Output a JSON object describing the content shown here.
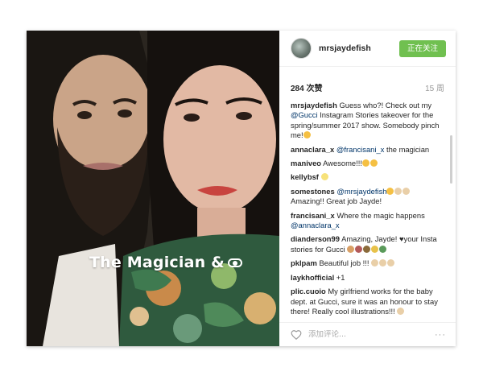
{
  "photo": {
    "overlay_text": "The Magician &"
  },
  "header": {
    "username": "mrsjaydefish",
    "follow_label": "正在关注"
  },
  "stats": {
    "likes": "284 次赞",
    "age": "15 周"
  },
  "comments": [
    {
      "user": "mrsjaydefish",
      "parts": [
        {
          "t": "Guess who?! Check out my "
        },
        {
          "t": "@Gucci",
          "m": true
        },
        {
          "t": " Instagram Stories takeover for the spring/summer 2017 show. Somebody pinch me!"
        }
      ],
      "emoji": [
        "#f5c043"
      ]
    },
    {
      "user": "annaclara_x",
      "parts": [
        {
          "t": "@francisani_x",
          "m": true
        },
        {
          "t": " the magician"
        }
      ],
      "emoji": []
    },
    {
      "user": "maniveo",
      "parts": [
        {
          "t": "Awesome!!!"
        }
      ],
      "emoji": [
        "#f5c043",
        "#f5c043"
      ]
    },
    {
      "user": "kellybsf",
      "parts": [
        {
          "t": ""
        }
      ],
      "emoji": [
        "#f7e27a"
      ]
    },
    {
      "user": "somestones",
      "parts": [
        {
          "t": "@mrsjaydefish",
          "m": true
        },
        {
          "t": " "
        },
        {
          "t": "Amazing!! Great job Jayde!"
        }
      ],
      "emoji_mid": [
        "#f5c043",
        "#e9cfa8",
        "#e9cfa8"
      ]
    },
    {
      "user": "francisani_x",
      "parts": [
        {
          "t": "Where the magic happens "
        },
        {
          "t": "@annaclara_x",
          "m": true
        }
      ],
      "emoji": []
    },
    {
      "user": "dianderson99",
      "parts": [
        {
          "t": "Amazing, Jayde! ♥your Insta stories for Gucci "
        }
      ],
      "emoji": [
        "#d9a066",
        "#b35a5a",
        "#8a6a3a",
        "#e8c24a",
        "#5a9a5a"
      ]
    },
    {
      "user": "pklpam",
      "parts": [
        {
          "t": "Beautiful job !!! "
        }
      ],
      "emoji": [
        "#e9cfa8",
        "#e9cfa8",
        "#e9cfa8"
      ]
    },
    {
      "user": "laykhofficial",
      "parts": [
        {
          "t": "+1"
        }
      ],
      "emoji": []
    },
    {
      "user": "plic.cuoio",
      "parts": [
        {
          "t": "My girlfriend works for the baby dept. at Gucci, sure it was an honour to stay there! Really cool illustrations!!! "
        }
      ],
      "emoji": [
        "#e9cfa8"
      ]
    }
  ],
  "footer": {
    "comment_placeholder": "添加评论...",
    "more_label": "···"
  },
  "colors": {
    "follow_button": "#70c050",
    "mention": "#003569"
  }
}
